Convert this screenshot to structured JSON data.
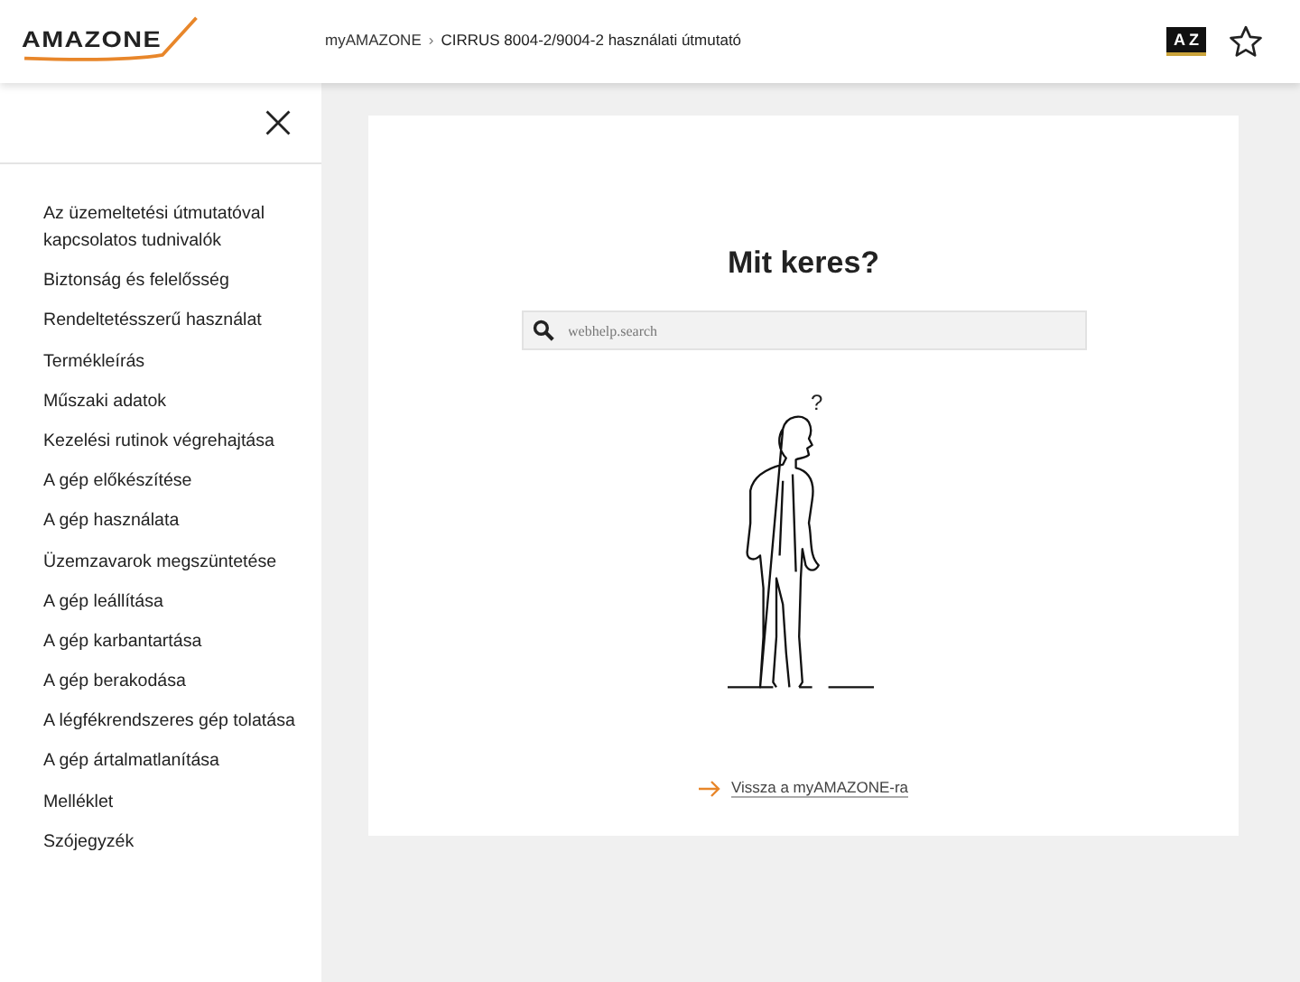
{
  "header": {
    "logo": "AMAZONE",
    "breadcrumb": [
      {
        "label": "myAMAZONE",
        "kind": "link"
      },
      {
        "label": "›",
        "kind": "separator"
      },
      {
        "label": "CIRRUS 8004-2/9004-2 használati útmutató",
        "kind": "current"
      }
    ],
    "glossary_button": {
      "letters": "AZ"
    }
  },
  "sidebar": {
    "items": [
      {
        "label": "Az üzemeltetési útmutatóval kapcsolatos tudnivalók"
      },
      {
        "label": "Biztonság és felelősség"
      },
      {
        "label": "Rendeltetésszerű használat"
      },
      {
        "label": "Termékleírás"
      },
      {
        "label": "Műszaki adatok"
      },
      {
        "label": "Kezelési rutinok végrehajtása"
      },
      {
        "label": "A gép előkészítése"
      },
      {
        "label": "A gép használata"
      },
      {
        "label": "Üzemzavarok megszüntetése"
      },
      {
        "label": "A gép leállítása"
      },
      {
        "label": "A gép karbantartása"
      },
      {
        "label": "A gép berakodása"
      },
      {
        "label": "A légfékrendszeres gép tolatása"
      },
      {
        "label": "A gép ártalmatlanítása"
      },
      {
        "label": "Melléklet"
      },
      {
        "label": "Szójegyzék"
      }
    ]
  },
  "main": {
    "title": "Mit keres?",
    "search": {
      "placeholder": "webhelp.search"
    },
    "illustration_mark": "?",
    "back_link": "Vissza a myAMAZONE-ra"
  }
}
